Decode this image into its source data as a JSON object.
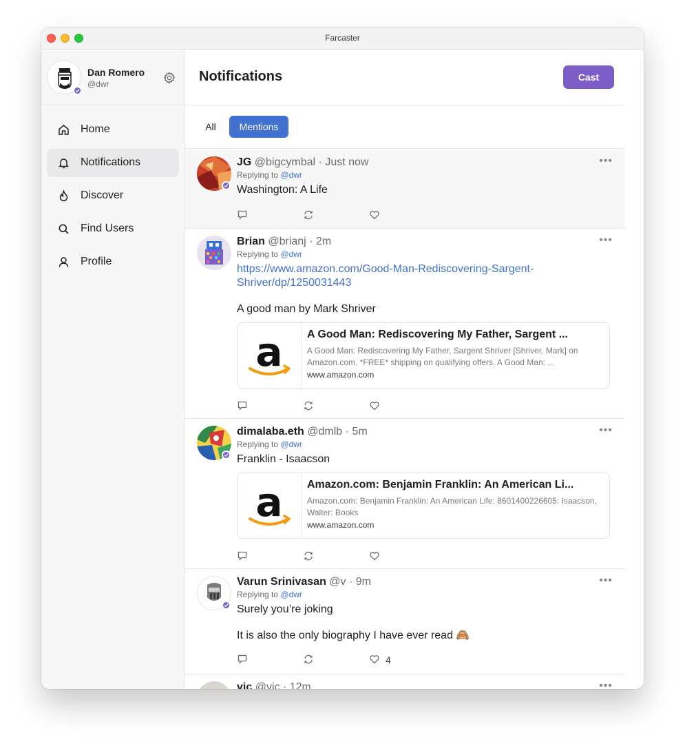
{
  "window": {
    "title": "Farcaster"
  },
  "profile": {
    "name": "Dan Romero",
    "handle": "@dwr"
  },
  "nav": [
    {
      "label": "Home",
      "icon": "home-icon"
    },
    {
      "label": "Notifications",
      "icon": "bell-icon",
      "active": true
    },
    {
      "label": "Discover",
      "icon": "flame-icon"
    },
    {
      "label": "Find Users",
      "icon": "search-icon"
    },
    {
      "label": "Profile",
      "icon": "user-icon"
    }
  ],
  "header": {
    "title": "Notifications",
    "cast_label": "Cast"
  },
  "tabs": {
    "all": "All",
    "mentions": "Mentions"
  },
  "colors": {
    "accent_purple": "#7c5ec8",
    "link_blue": "#4271d0"
  },
  "feed": [
    {
      "author": "JG",
      "handle": "@bigcymbal",
      "time": "Just now",
      "replying_prefix": "Replying to",
      "replying_to": "@dwr",
      "text": "Washington: A Life"
    },
    {
      "author": "Brian",
      "handle": "@brianj",
      "time": "2m",
      "replying_prefix": "Replying to",
      "replying_to": "@dwr",
      "link": "https://www.amazon.com/Good-Man-Rediscovering-Sargent-Shriver/dp/1250031443",
      "text": "A good man by Mark Shriver",
      "embed": {
        "title": "A Good Man: Rediscovering My Father, Sargent ...",
        "description": "A Good Man: Rediscovering My Father, Sargent Shriver [Shriver, Mark] on Amazon.com. *FREE* shipping on qualifying offers. A Good Man: ...",
        "domain": "www.amazon.com"
      }
    },
    {
      "author": "dimalaba.eth",
      "handle": "@dmlb",
      "time": "5m",
      "replying_prefix": "Replying to",
      "replying_to": "@dwr",
      "text": "Franklin - Isaacson",
      "embed": {
        "title": "Amazon.com: Benjamin Franklin: An American Li...",
        "description": "Amazon.com: Benjamin Franklin: An American Life: 8601400226605: Isaacson, Walter: Books",
        "domain": "www.amazon.com"
      }
    },
    {
      "author": "Varun Srinivasan",
      "handle": "@v",
      "time": "9m",
      "replying_prefix": "Replying to",
      "replying_to": "@dwr",
      "text": "Surely you’re joking",
      "text2": "It is also the only biography I have ever read 🙈",
      "likes": "4"
    },
    {
      "author": "vic",
      "handle": "@vic",
      "time": "12m"
    }
  ]
}
